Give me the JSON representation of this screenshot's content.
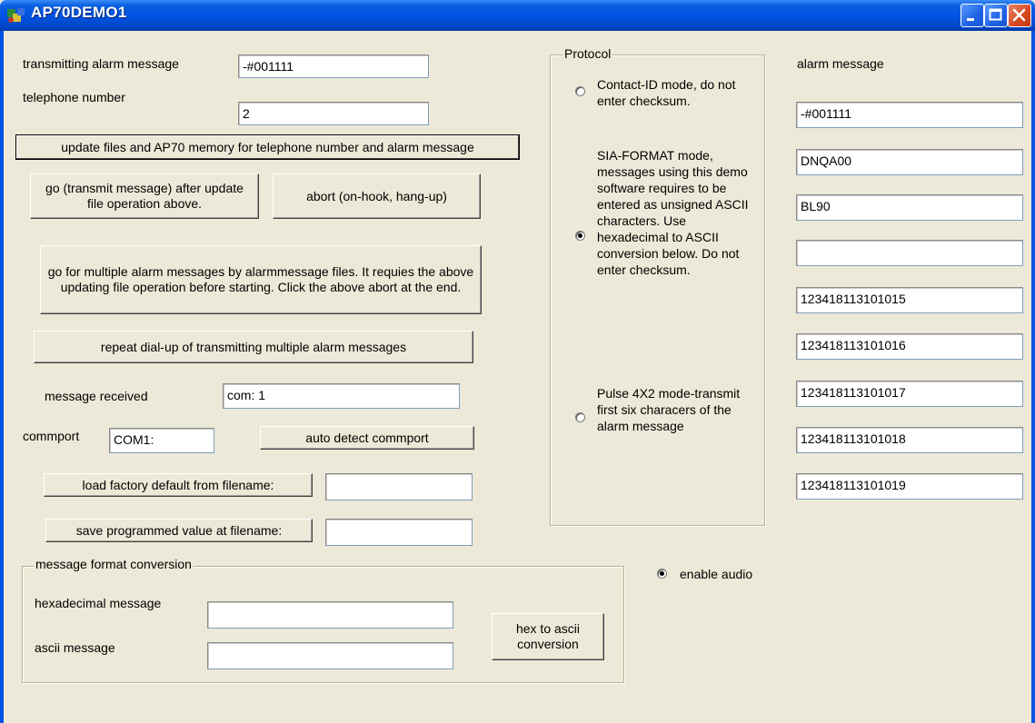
{
  "window": {
    "title": "AP70DEMO1"
  },
  "form": {
    "transmitting_label": "transmitting alarm message",
    "transmitting_value": "-#001111",
    "telephone_label": "telephone number",
    "telephone_value": "2",
    "update_button": "update files and AP70 memory for telephone number and alarm message",
    "go_button": "go (transmit message) after update file operation above.",
    "abort_button": "abort (on-hook, hang-up)",
    "multi_button": "go for multiple alarm messages by alarmmessage files. It requies the above updating file operation before starting. Click the above abort at the end.",
    "repeat_button": "repeat dial-up of transmitting multiple alarm messages",
    "received_label": "message received",
    "received_value": "com: 1",
    "commport_label": "commport",
    "commport_value": "COM1:",
    "autodetect_button": "auto detect commport",
    "load_button": "load factory default from filename:",
    "load_value": "",
    "save_button": "save programmed value at filename:",
    "save_value": ""
  },
  "conversion": {
    "group_title": "message format conversion",
    "hex_label": "hexadecimal message",
    "hex_value": "",
    "ascii_label": "ascii message",
    "ascii_value": "",
    "convert_button": "hex to ascii conversion"
  },
  "protocol": {
    "group_title": "Protocol",
    "options": [
      {
        "label": "Contact-ID mode, do not enter checksum.",
        "selected": false
      },
      {
        "label": "SIA-FORMAT mode, messages using this demo software requires to be entered as unsigned ASCII characters. Use hexadecimal to ASCII conversion below. Do not enter checksum.",
        "selected": true
      },
      {
        "label": "Pulse 4X2 mode-transmit first six characers of the alarm message",
        "selected": false
      }
    ]
  },
  "audio": {
    "label": "enable audio",
    "selected": true
  },
  "alarm_list": {
    "label": "alarm message",
    "values": [
      "-#001111",
      "DNQA00",
      "BL90",
      "",
      "123418113101015",
      "123418113101016",
      "123418113101017",
      "123418113101018",
      "123418113101019"
    ]
  }
}
